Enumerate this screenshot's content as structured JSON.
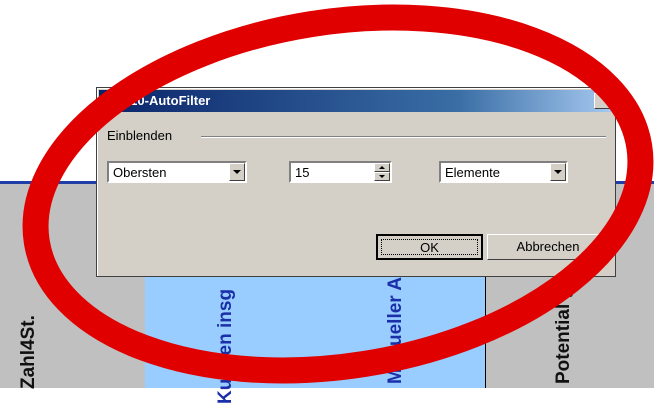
{
  "dialog": {
    "title": "Top-10-AutoFilter",
    "group_label": "Einblenden",
    "direction": {
      "value": "Obersten"
    },
    "count": {
      "value": "15"
    },
    "unit": {
      "value": "Elemente"
    },
    "ok_label": "OK",
    "cancel_label": "Abbrechen"
  },
  "sheet": {
    "headers": [
      "Zahl4St.",
      "Kunden insg",
      "Manueller Ar",
      "Potential ge"
    ]
  },
  "colors": {
    "titlebar_start": "#0a246a",
    "dialog_face": "#d4d0c8",
    "highlight_column": "#99ccff",
    "header_gray": "#c0c0c0",
    "annotation_red": "#e00000"
  }
}
